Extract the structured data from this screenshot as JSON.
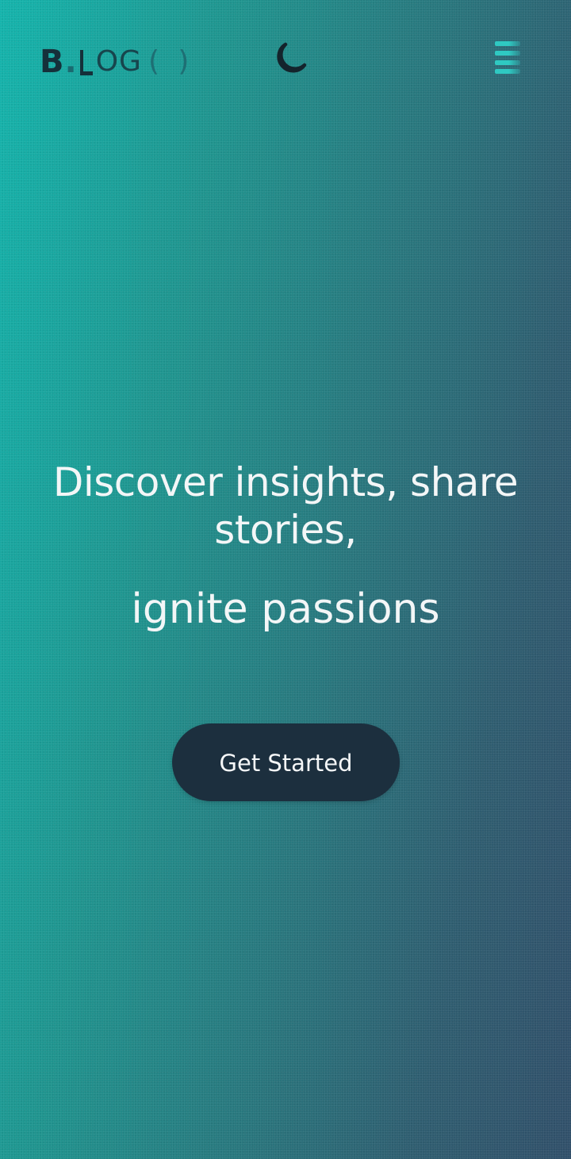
{
  "header": {
    "logo": {
      "letter_b": "B",
      "dot": ".",
      "rest": "OG",
      "parens": "( )"
    },
    "theme_toggle_icon": "moon-icon",
    "menu_icon": "hamburger-menu-icon"
  },
  "hero": {
    "headline_part1": "Discover insights, share stories,",
    "headline_part2": "ignite passions",
    "cta_label": "Get Started"
  },
  "colors": {
    "gradient_start": "#14b4ac",
    "gradient_end": "#31506a",
    "cta_background": "#1c2f3e",
    "text": "#f3f6f7",
    "menu_accent": "#2fc9c2"
  }
}
